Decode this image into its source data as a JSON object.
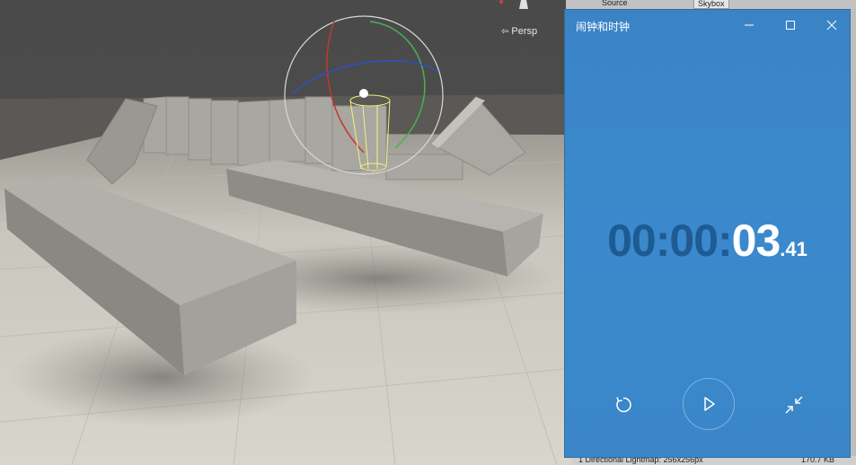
{
  "scene": {
    "view_mode_label": "Persp"
  },
  "inspector": {
    "source_label": "Source",
    "source_value": "Skybox"
  },
  "status_bar": {
    "lightmap_text": "1 Directional Lightmap: 256x256px",
    "size_text": "170.7 KB"
  },
  "clock_app": {
    "title": "闹钟和时钟",
    "time": {
      "dim_part": "00:00:",
      "seconds": "03",
      "hundredths": ".41"
    },
    "controls": {
      "reset_icon": "reset-icon",
      "play_icon": "play-icon",
      "compact_icon": "compact-overlay-icon"
    },
    "colors": {
      "background": "#3a86c8",
      "dim_digits": "#1e5b92",
      "active_digits": "#ffffff"
    }
  }
}
